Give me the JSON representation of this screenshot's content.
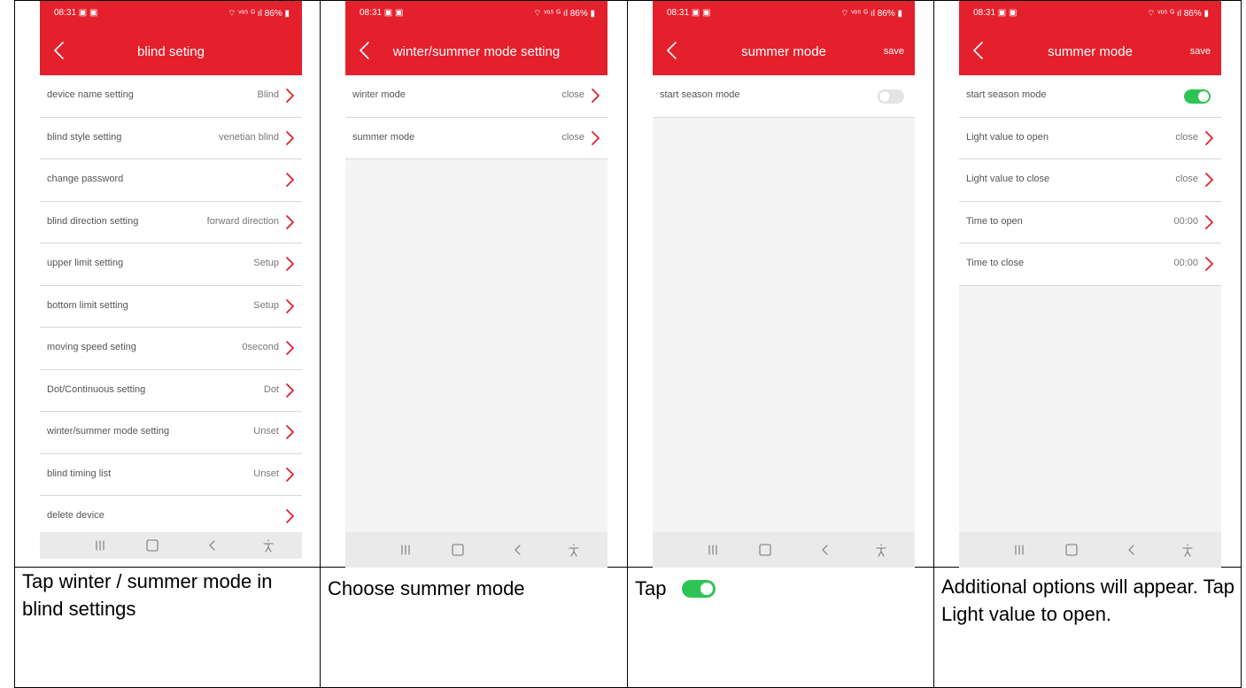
{
  "screens": [
    {
      "status": {
        "time": "08:31 ▣ ▣",
        "system": "⌔ ᵛᵒ⁵ ᴳ ıl 86% ▮"
      },
      "title": "blind seting",
      "rows": [
        {
          "label": "device name setting",
          "value": "Blind"
        },
        {
          "label": "blind style setting",
          "value": "venetian blind"
        },
        {
          "label": "change password",
          "value": ""
        },
        {
          "label": "blind direction setting",
          "value": "forward direction"
        },
        {
          "label": "upper limit setting",
          "value": "Setup"
        },
        {
          "label": "bottom limit setting",
          "value": "Setup"
        },
        {
          "label": "moving speed seting",
          "value": "0second"
        },
        {
          "label": "Dot/Continuous setting",
          "value": "Dot"
        },
        {
          "label": "winter/summer mode setting",
          "value": "Unset"
        },
        {
          "label": "blind timing list",
          "value": "Unset"
        },
        {
          "label": "delete device",
          "value": ""
        }
      ]
    },
    {
      "status": {
        "time": "08:31 ▣ ▣",
        "system": "⌔ ᵛᵒ⁵ ᴳ ıl 86% ▮"
      },
      "title": "winter/summer mode setting",
      "rows": [
        {
          "label": "winter mode",
          "value": "close"
        },
        {
          "label": "summer mode",
          "value": "close"
        }
      ]
    },
    {
      "status": {
        "time": "08:31 ▣ ▣",
        "system": "⌔ ᵛᵒ⁵ ᴳ ıl 86% ▮"
      },
      "title": "summer mode",
      "save": "save",
      "rows": [
        {
          "label": "start season mode",
          "toggle": false
        }
      ]
    },
    {
      "status": {
        "time": "08:31 ▣ ▣",
        "system": "⌔ ᵛᵒ⁵ ᴳ ıl 86% ▮"
      },
      "title": "summer mode",
      "save": "save",
      "rows": [
        {
          "label": "start season mode",
          "toggle": true
        },
        {
          "label": "Light value to open",
          "value": "close"
        },
        {
          "label": "Light value to close",
          "value": "close"
        },
        {
          "label": "Time to open",
          "value": "00:00"
        },
        {
          "label": "Time to close",
          "value": "00:00"
        }
      ]
    }
  ],
  "captions": [
    "Tap winter / summer mode in blind settings",
    "Choose summer mode",
    "Tap",
    "Additional options will appear. Tap Light value to open."
  ],
  "colors": {
    "header": "#e4202c",
    "toggle_on": "#2ec455",
    "chevron": "#e4202c"
  }
}
